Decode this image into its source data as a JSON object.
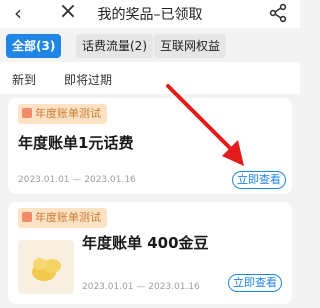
{
  "header": {
    "back_icon": "chevron-left-icon",
    "close_icon": "close-icon",
    "title": "我的奖品–已领取",
    "share_icon": "share-icon"
  },
  "tabs": [
    {
      "label": "全部(3)",
      "active": true
    },
    {
      "label": "话费流量(2)",
      "active": false
    },
    {
      "label": "互联网权益",
      "active": false
    }
  ],
  "subtabs": [
    "新到",
    "即将过期"
  ],
  "cards": [
    {
      "badge": "年度账单测试",
      "title": "年度账单1元话费",
      "date": "2023.01.01 — 2023.01.16",
      "button": "立即查看"
    },
    {
      "badge": "年度账单测试",
      "title": "年度账单 400金豆",
      "date": "2023.01.01 — 2023.01.16",
      "button": "立即查看",
      "thumb_icon": "gold-beans-icon"
    }
  ],
  "colors": {
    "accent": "#1f86e6",
    "badge_bg": "#fde3c4",
    "badge_text": "#c77a33",
    "arrow": "#e21c1c"
  }
}
